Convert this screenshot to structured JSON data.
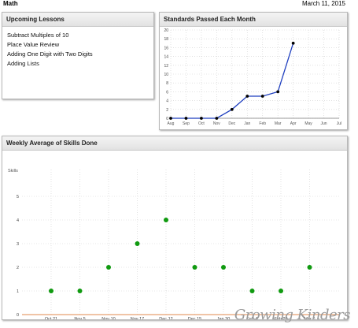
{
  "header": {
    "subject": "Math",
    "date": "March 11, 2015"
  },
  "lessons_panel": {
    "title": "Upcoming Lessons",
    "items": [
      "Subtract Multiples of 10",
      "Place Value Review",
      "Adding One Digit with Two Digits",
      "Adding Lists"
    ]
  },
  "standards_panel": {
    "title": "Standards Passed Each Month"
  },
  "weekly_panel": {
    "title": "Weekly Average of Skills Done"
  },
  "watermark": "Growing Kinders",
  "colors": {
    "line": "#1f3fbf",
    "points": "#109a10",
    "axis": "#e8a070"
  },
  "chart_data": [
    {
      "type": "line",
      "title": "Standards Passed Each Month",
      "categories": [
        "Aug",
        "Sep",
        "Oct",
        "Nov",
        "Dec",
        "Jan",
        "Feb",
        "Mar",
        "Apr",
        "May",
        "Jun",
        "Jul"
      ],
      "values": [
        0,
        0,
        0,
        0,
        2,
        5,
        5,
        6,
        17,
        null,
        null,
        null
      ],
      "ylim": [
        0,
        20
      ],
      "yticks": [
        0,
        2,
        4,
        6,
        8,
        10,
        12,
        14,
        16,
        18,
        20
      ],
      "grid": true
    },
    {
      "type": "scatter",
      "title": "Weekly Average of Skills Done",
      "ylabel": "Skills",
      "categories": [
        "Oct 21",
        "Nov 5",
        "Nov 10",
        "Nov 17",
        "Dec 12",
        "Dec 15",
        "Jan 30",
        "Feb 4",
        "Feb 20",
        "Mar 6"
      ],
      "values": [
        1,
        1,
        2,
        3,
        4,
        2,
        2,
        1,
        1,
        2
      ],
      "ylim": [
        0,
        6
      ],
      "yticks": [
        0,
        1,
        2,
        3,
        4,
        5
      ],
      "grid": true
    }
  ]
}
